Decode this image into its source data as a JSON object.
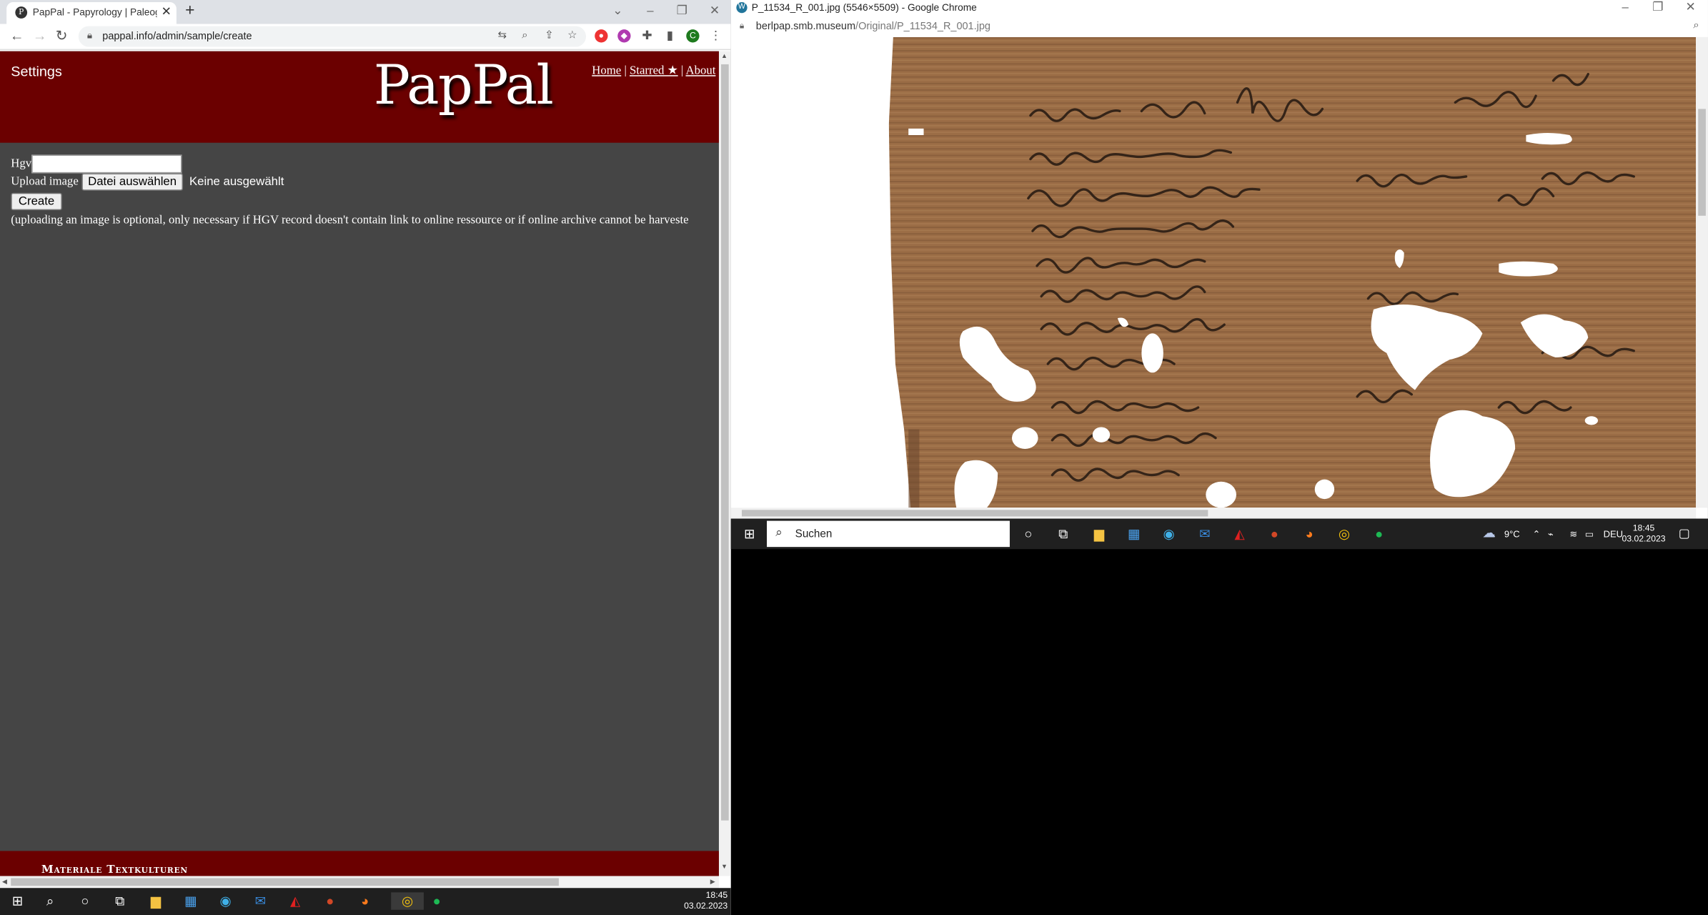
{
  "left_window": {
    "tab_title": "PapPal - Papyrology | Paleograph",
    "favicon_letter": "P",
    "url": "pappal.info/admin/sample/create",
    "profile_letter": "C",
    "page": {
      "settings_label": "Settings",
      "logo": "PapPal",
      "nav": {
        "home": "Home",
        "starred": "Starred ★",
        "about": "About",
        "sep": "|"
      },
      "form": {
        "hgv_label": "Hgv",
        "hgv_value": "",
        "upload_label": "Upload image",
        "choose_file_button": "Datei auswählen",
        "no_file_text": "Keine ausgewählt",
        "create_button": "Create",
        "note": "(uploading an image is optional, only necessary if HGV record doesn't contain link to online ressource or if online archive cannot be harveste"
      },
      "footer_text": "Materiale Textkulturen"
    },
    "clock": {
      "time": "18:45",
      "date": "03.02.2023"
    }
  },
  "right_window": {
    "title": "P_11534_R_001.jpg (5546×5509) - Google Chrome",
    "favicon_letter": "W",
    "url_host": "berlpap.smb.museum",
    "url_path": "/Original/P_11534_R_001.jpg",
    "taskbar": {
      "search_placeholder": "Suchen",
      "weather": "9°C",
      "language": "DEU",
      "time": "18:45",
      "date": "03.02.2023"
    }
  },
  "icons": {
    "left_taskbar": [
      "windows-icon",
      "search-icon",
      "cortana-icon",
      "task-view-icon",
      "file-explorer-icon",
      "store-icon",
      "edge-icon",
      "mail-icon",
      "acrobat-icon",
      "powerpoint-icon",
      "firefox-icon",
      "chrome-icon",
      "spotify-icon"
    ],
    "right_taskbar": [
      "windows-icon",
      "cortana-icon",
      "task-view-icon",
      "file-explorer-icon",
      "store-icon",
      "edge-icon",
      "mail-icon",
      "acrobat-icon",
      "powerpoint-icon",
      "firefox-icon",
      "chrome-icon",
      "spotify-icon"
    ]
  },
  "colors": {
    "header_bg": "#6b0000",
    "page_bg": "#454545",
    "papyrus": "#9a6b44"
  }
}
